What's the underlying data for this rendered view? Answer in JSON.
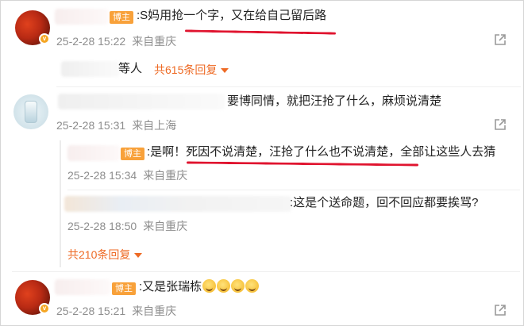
{
  "comments": [
    {
      "tag": "博主",
      "text": ":S妈用抢一个字，又在给自己留后路",
      "date": "25-2-28 15:22",
      "source": "来自重庆"
    },
    {
      "reply_count_text": "等人",
      "replies_link": "共615条回复"
    },
    {
      "text": "要博同情，就把汪抢了什么，麻烦说清楚",
      "date": "25-2-28 15:31",
      "source": "来自上海"
    },
    {
      "tag": "博主",
      "text_prefix": ":是啊！",
      "text_underlined": "死因不说清楚，汪抢了什么也不说清楚",
      "text_suffix": "，全部让这些人去猜",
      "date": "25-2-28 15:34",
      "source": "来自重庆"
    },
    {
      "text": ":这是个送命题，回不回应都要挨骂?",
      "date": "25-2-28 18:50",
      "source": "来自重庆",
      "replies_link": "共210条回复"
    },
    {
      "tag": "博主",
      "text": ":又是张瑞栋",
      "emoji_count": 4,
      "date": "25-2-28 15:21",
      "source": "来自重庆"
    }
  ],
  "icons": {
    "share": "share-icon",
    "verified": "verified-badge-icon",
    "expand": "chevron-down-icon"
  },
  "colors": {
    "tag_bg": "#f8a13a",
    "reply_link": "#ee6a24",
    "underline": "#e0142f",
    "meta": "#8e8e8e"
  }
}
